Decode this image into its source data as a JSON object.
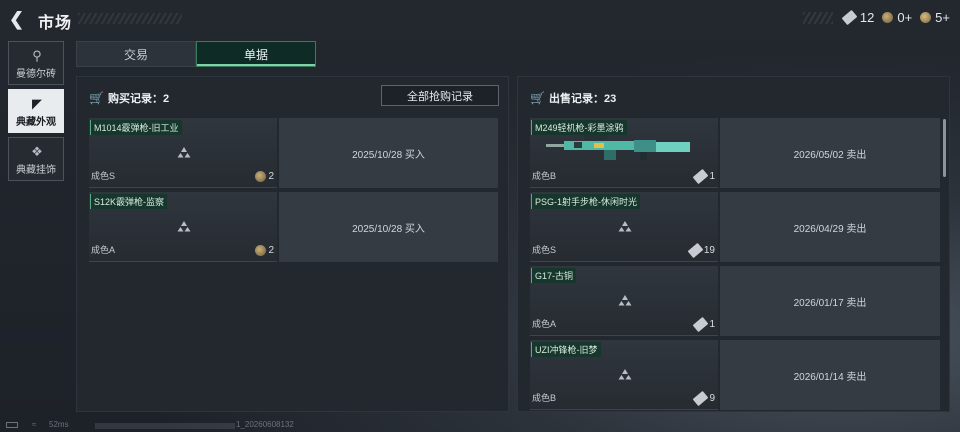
{
  "header": {
    "back_icon": "chevron-left-icon",
    "title": "市场"
  },
  "currency": [
    {
      "icon": "ticket-icon",
      "value": "12"
    },
    {
      "icon": "coin-icon",
      "value": "0+"
    },
    {
      "icon": "gold-coin-icon",
      "value": "5+"
    }
  ],
  "sidebar": {
    "items": [
      {
        "label": "曼德尔砖",
        "icon": "brick-icon",
        "active": false
      },
      {
        "label": "典藏外观",
        "icon": "pistol-icon",
        "active": true
      },
      {
        "label": "典藏挂饰",
        "icon": "charm-icon",
        "active": false
      }
    ]
  },
  "tabs": [
    {
      "label": "交易",
      "active": false
    },
    {
      "label": "单据",
      "active": true
    }
  ],
  "buy": {
    "title": "购买记录：2",
    "buy_all_label": "全部抢购记录",
    "rows": [
      {
        "name": "M1014霰弹枪-旧工业",
        "grade": "成色S",
        "count": "2",
        "info": "2025/10/28 买入"
      },
      {
        "name": "S12K霰弹枪-监察",
        "grade": "成色A",
        "count": "2",
        "info": "2025/10/28 买入"
      }
    ]
  },
  "sell": {
    "title": "出售记录：23",
    "rows": [
      {
        "name": "M249轻机枪-彩墨涂鸦",
        "grade": "成色B",
        "count": "1",
        "info": "2026/05/02 卖出"
      },
      {
        "name": "PSG-1射手步枪-休闲时光",
        "grade": "成色S",
        "count": "19",
        "info": "2026/04/29 卖出"
      },
      {
        "name": "G17-古铜",
        "grade": "成色A",
        "count": "1",
        "info": "2026/01/17 卖出"
      },
      {
        "name": "UZI冲锋枪-旧梦",
        "grade": "成色B",
        "count": "9",
        "info": "2026/01/14 卖出"
      }
    ]
  },
  "footer": {
    "latency": "52ms",
    "build_id": "1_20260608132"
  }
}
